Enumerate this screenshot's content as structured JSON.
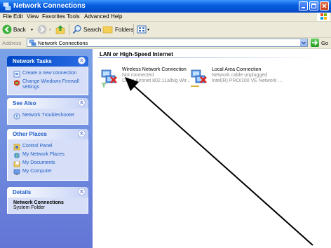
{
  "window": {
    "title": "Network Connections"
  },
  "menu": [
    "File",
    "Edit",
    "View",
    "Favorites",
    "Tools",
    "Advanced",
    "Help"
  ],
  "toolbar": {
    "back": "Back",
    "search": "Search",
    "folders": "Folders"
  },
  "address": {
    "label": "Address",
    "value": "Network Connections",
    "go": "Go"
  },
  "tasks": {
    "network_tasks": {
      "title": "Network Tasks",
      "items": [
        "Create a new connection",
        "Change Windows Firewall settings"
      ]
    },
    "see_also": {
      "title": "See Also",
      "items": [
        "Network Troubleshooter"
      ]
    },
    "other_places": {
      "title": "Other Places",
      "items": [
        "Control Panel",
        "My Network Places",
        "My Documents",
        "My Computer"
      ]
    },
    "details": {
      "title": "Details",
      "name": "Network Connections",
      "subtitle": "System Folder"
    }
  },
  "group": {
    "header": "LAN or High-Speed Internet"
  },
  "connections": [
    {
      "name": "Wireless Network Connection",
      "status": "Not connected",
      "device": "Cisco Aironet 802.11a/b/g Wir..."
    },
    {
      "name": "Local Area Connection",
      "status": "Network cable unplugged",
      "device": "Intel(R) PRO/100 VE Network ..."
    }
  ],
  "colors": {
    "titlebar": "#0a5fe0",
    "taskpane": "#7ba2e7",
    "link": "#215dc6",
    "arrow": "#000000"
  }
}
